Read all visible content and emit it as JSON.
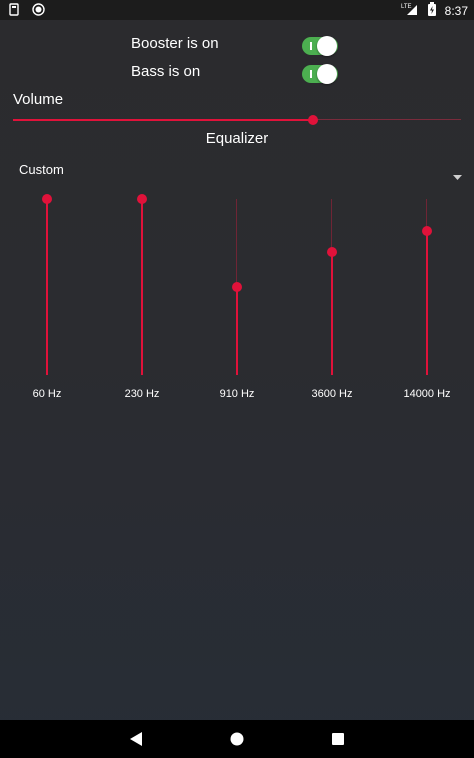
{
  "status_bar": {
    "time": "8:37",
    "network": "LTE",
    "icons": [
      "android-debug-icon",
      "record-icon",
      "lte-signal-icon",
      "battery-icon"
    ]
  },
  "booster": {
    "label": "Booster is on",
    "on": true
  },
  "bass": {
    "label": "Bass is on",
    "on": true
  },
  "volume": {
    "label": "Volume",
    "level": 0.67
  },
  "equalizer": {
    "title": "Equalizer",
    "preset": "Custom",
    "bands": [
      {
        "label": "60 Hz",
        "level": 1.0
      },
      {
        "label": "230 Hz",
        "level": 1.0
      },
      {
        "label": "910 Hz",
        "level": 0.5
      },
      {
        "label": "3600 Hz",
        "level": 0.7
      },
      {
        "label": "14000 Hz",
        "level": 0.82
      }
    ]
  },
  "colors": {
    "accent": "#e0123a",
    "switch_on": "#4caf50",
    "background_top": "#2b2b2e",
    "background_bottom": "#272d36"
  },
  "nav": {
    "icons": [
      "back-icon",
      "home-icon",
      "recents-icon"
    ]
  }
}
